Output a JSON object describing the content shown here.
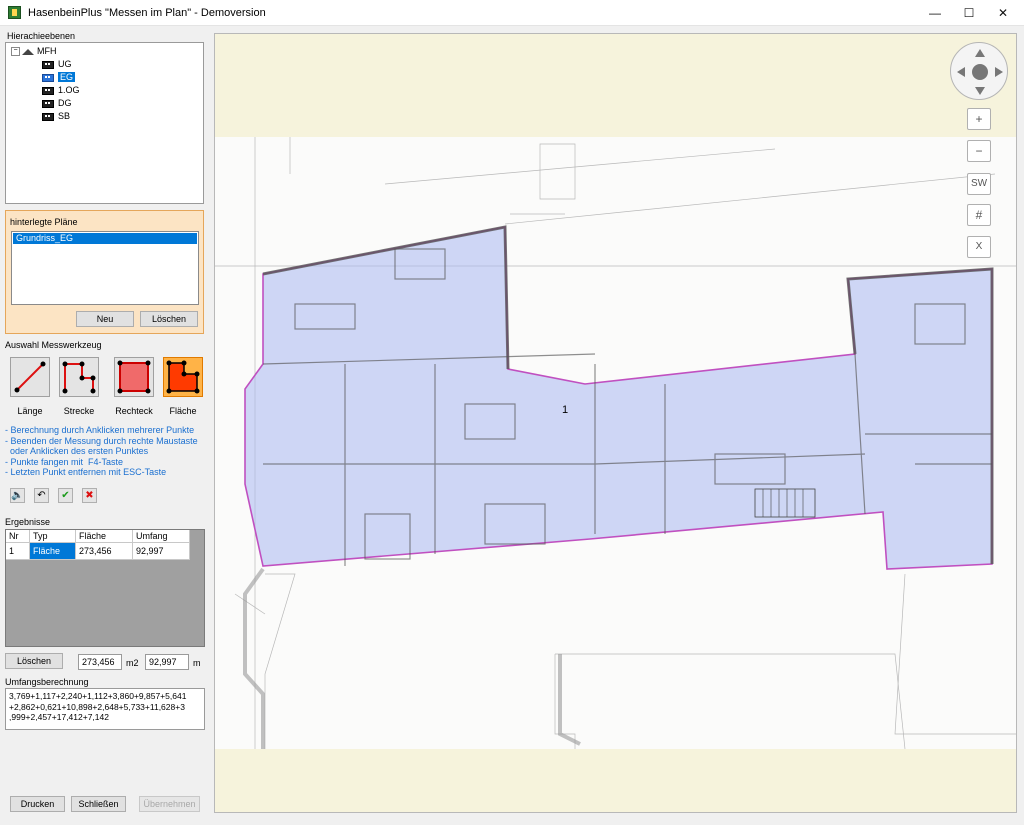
{
  "window": {
    "title": "HasenbeinPlus \"Messen im Plan\" - Demoversion",
    "controls": [
      "—",
      "☐",
      "✕"
    ]
  },
  "tree": {
    "section_label": "Hierachieebenen",
    "root": "MFH",
    "levels": [
      "UG",
      "EG",
      "1.OG",
      "DG",
      "SB"
    ],
    "selected": "EG"
  },
  "plans": {
    "section_label": "hinterlegte Pläne",
    "items": [
      "Grundriss_EG"
    ],
    "new_label": "Neu",
    "delete_label": "Löschen"
  },
  "tools": {
    "section_label": "Auswahl Messwerkzeug",
    "items": [
      {
        "name": "Länge",
        "icon": "line-tool-icon"
      },
      {
        "name": "Strecke",
        "icon": "polyline-tool-icon"
      },
      {
        "name": "Rechteck",
        "icon": "rectangle-tool-icon"
      },
      {
        "name": "Fläche",
        "icon": "area-tool-icon"
      }
    ],
    "active": "Fläche"
  },
  "hints": [
    "- Berechnung durch Anklicken mehrerer Punkte",
    "- Beenden der Messung durch rechte Maustaste",
    "  oder Anklicken des ersten Punktes",
    "- Punkte fangen mit  F4-Taste",
    "- Letzten Punkt entfernen mit ESC-Taste"
  ],
  "results": {
    "section_label": "Ergebnisse",
    "columns": [
      "Nr",
      "Typ",
      "Fläche",
      "Umfang"
    ],
    "rows": [
      [
        "1",
        "Fläche",
        "273,456",
        "92,997"
      ]
    ],
    "delete_label": "Löschen",
    "area_value": "273,456",
    "area_unit": "m2",
    "perimeter_value": "92,997",
    "perimeter_unit": "m"
  },
  "perimeter_calc": {
    "section_label": "Umfangsberechnung",
    "lines": [
      "3,769+1,117+2,240+1,112+3,860+9,857+5,641",
      "+2,862+0,621+10,898+2,648+5,733+11,628+3",
      ",999+2,457+17,412+7,142"
    ]
  },
  "footer": {
    "print_label": "Drucken",
    "close_label": "Schließen",
    "apply_label": "Übernehmen"
  },
  "map": {
    "room_number": "1",
    "buttons": [
      "+",
      "−",
      "SW",
      "#",
      "X"
    ],
    "highlight_color": "#c050c0",
    "fill_color": "#aab8f0"
  }
}
